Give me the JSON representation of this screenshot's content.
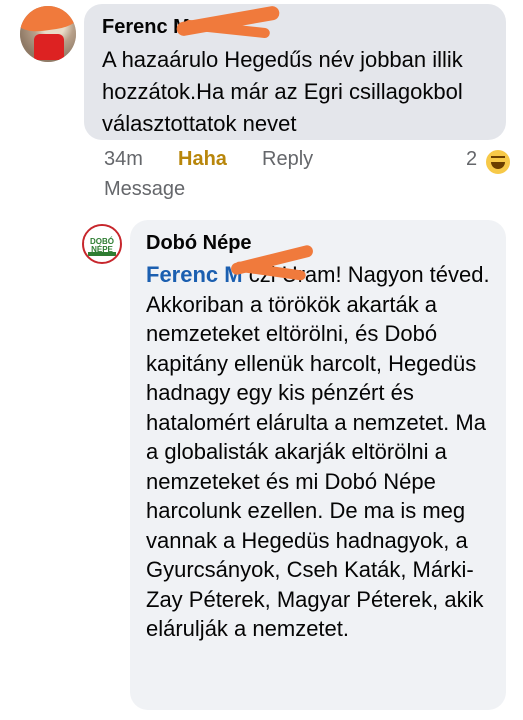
{
  "comment": {
    "author": "Ferenc M",
    "text": "A hazaárulo Hegedűs név jobban illik hozzátok.Ha már az Egri csillagokbol választottatok nevet",
    "time": "34m",
    "haha_label": "Haha",
    "reply_label": "Reply",
    "reaction_count": "2",
    "reaction_icon": "haha-emoji-icon",
    "message_label": "Message"
  },
  "reply": {
    "author": "Dobó Népe",
    "avatar_text": "DOBÓ NÉPE",
    "mention": "Ferenc M",
    "text": "czi Uram! Nagyon téved. Akkoriban a törökök akarták a nemzeteket eltörölni, és Dobó kapitány ellenük harcolt, Hegedüs hadnagy egy kis pénzért és hatalomért elárulta a nemzetet. Ma a globalisták akarják eltörölni a nemzeteket és mi Dobó Népe harcolunk ezellen. De ma is meg vannak a Hegedüs hadnagyok, a Gyurcsányok, Cseh Katák, Márki-Zay Péterek, Magyar Péterek, akik elárulják a nemzetet."
  },
  "colors": {
    "bubble": "#e4e6eb",
    "reply_bubble": "#f0f2f5",
    "mention": "#1b5fb0",
    "haha": "#b8860b",
    "redaction": "#f07a3c"
  }
}
